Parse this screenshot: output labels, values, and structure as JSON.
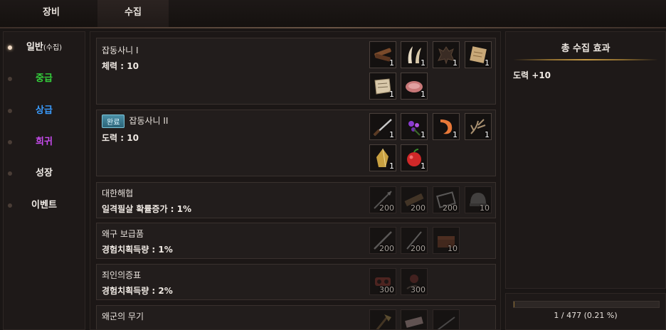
{
  "top_tabs": [
    {
      "label": "장비"
    },
    {
      "label": "수집"
    }
  ],
  "sidebar": {
    "items": [
      {
        "label": "일반",
        "sub": "(수집)",
        "color": "#f2ede8"
      },
      {
        "label": "중급",
        "color": "#34d23c"
      },
      {
        "label": "상급",
        "color": "#3a9cff"
      },
      {
        "label": "희귀",
        "color": "#c94cf0"
      },
      {
        "label": "성장",
        "color": "#f2ede8"
      },
      {
        "label": "이벤트",
        "color": "#f2ede8"
      }
    ]
  },
  "cards": [
    {
      "title": "잡동사니 I",
      "stat": "체력 : 10",
      "items": [
        {
          "icon": "wood-bundle-icon",
          "count": "1"
        },
        {
          "icon": "tusk-icon",
          "count": "1"
        },
        {
          "icon": "hide-icon",
          "count": "1"
        },
        {
          "icon": "scroll-icon",
          "count": "1"
        },
        {
          "icon": "paper-icon",
          "count": "1"
        },
        {
          "icon": "meat-icon",
          "count": "1"
        }
      ]
    },
    {
      "badge": "완료",
      "title": "잡동사니 II",
      "stat": "도력 : 10",
      "items": [
        {
          "icon": "knife-icon",
          "count": "1"
        },
        {
          "icon": "flower-icon",
          "count": "1"
        },
        {
          "icon": "shrimp-icon",
          "count": "1"
        },
        {
          "icon": "antler-icon",
          "count": "1"
        },
        {
          "icon": "crystal-icon",
          "count": "1"
        },
        {
          "icon": "apple-icon",
          "count": "1"
        }
      ]
    },
    {
      "title": "대한해협",
      "stat": "일격필살 확률증가 : 1%",
      "items": [
        {
          "icon": "spear-icon",
          "count": "200"
        },
        {
          "icon": "plank-icon",
          "count": "200"
        },
        {
          "icon": "frame-icon",
          "count": "200"
        },
        {
          "icon": "helmet-icon",
          "count": "10"
        }
      ]
    },
    {
      "title": "왜구 보급품",
      "stat": "경험치획득량 : 1%",
      "items": [
        {
          "icon": "sword-icon",
          "count": "200"
        },
        {
          "icon": "blade-icon",
          "count": "200"
        },
        {
          "icon": "chest-icon",
          "count": "10"
        }
      ]
    },
    {
      "title": "죄인의증표",
      "stat": "경험치획득량 : 2%",
      "items": [
        {
          "icon": "shackle-icon",
          "count": "300"
        },
        {
          "icon": "chain-icon",
          "count": "300"
        }
      ]
    },
    {
      "title": "왜군의 무기",
      "stat": "",
      "items": [
        {
          "icon": "axe-icon",
          "count": ""
        },
        {
          "icon": "bone-icon",
          "count": ""
        },
        {
          "icon": "rod-icon",
          "count": ""
        }
      ]
    }
  ],
  "summary": {
    "title": "총 수집 효과",
    "effect": "도력 +10"
  },
  "progress": {
    "text": "1 / 477 (0.21 %)",
    "fraction": 0.0021
  }
}
